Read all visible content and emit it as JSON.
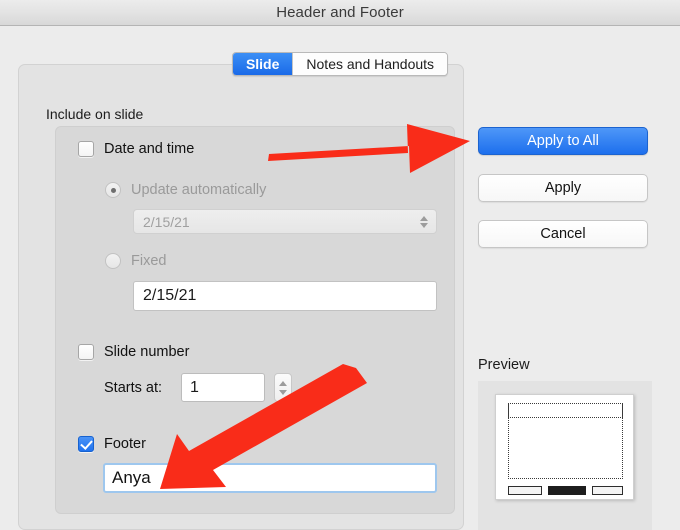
{
  "window": {
    "title": "Header and Footer"
  },
  "tabs": [
    {
      "label": "Slide",
      "active": true
    },
    {
      "label": "Notes and Handouts",
      "active": false
    }
  ],
  "main": {
    "group_label": "Include on slide",
    "date_and_time": {
      "checkbox_label": "Date and time",
      "checked": false,
      "update_automatically": {
        "label": "Update automatically",
        "selected": true,
        "value": "2/15/21"
      },
      "fixed": {
        "label": "Fixed",
        "selected": false,
        "value": "2/15/21"
      }
    },
    "slide_number": {
      "checkbox_label": "Slide number",
      "checked": false,
      "starts_at_label": "Starts at:",
      "starts_at_value": "1"
    },
    "footer": {
      "checkbox_label": "Footer",
      "checked": true,
      "value": "Anya"
    }
  },
  "buttons": {
    "apply_to_all": "Apply to All",
    "apply": "Apply",
    "cancel": "Cancel"
  },
  "preview": {
    "label": "Preview"
  },
  "colors": {
    "accent_blue": "#1d6fed",
    "annotation_red": "#f92c19",
    "window_bg": "#ececec",
    "panel_bg": "#e3e3e3",
    "group_bg": "#d8d8d8"
  },
  "annotations": [
    {
      "name": "arrow-to-apply-to-all",
      "points_to": "Apply to All",
      "direction": "right"
    },
    {
      "name": "arrow-to-footer-input",
      "points_to": "Footer text field",
      "direction": "down-left"
    }
  ]
}
